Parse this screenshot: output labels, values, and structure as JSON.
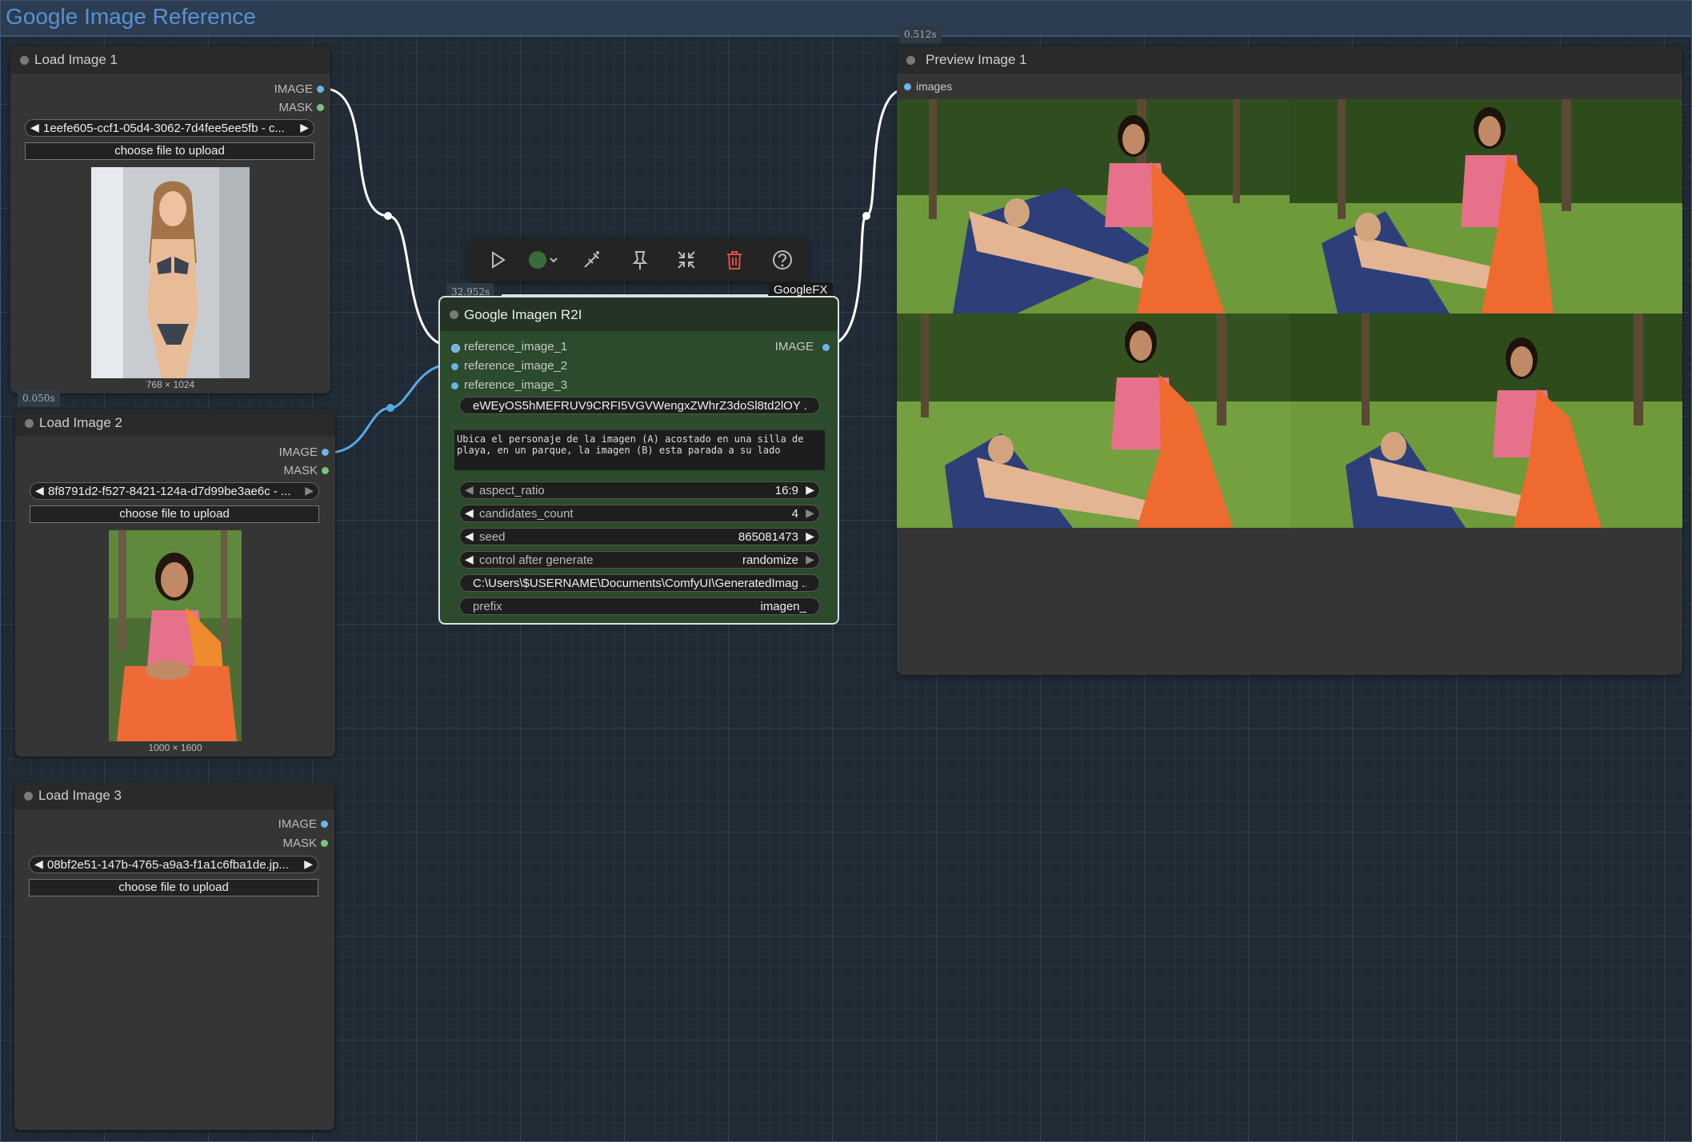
{
  "group": {
    "title": "Google Image Reference"
  },
  "nodes": {
    "load1": {
      "title": "Load Image 1",
      "outputs": [
        "IMAGE",
        "MASK"
      ],
      "file": "1eefe605-ccf1-05d4-3062-7d4fee5ee5fb - c...",
      "upload_label": "choose file to upload",
      "size": "768 × 1024"
    },
    "load2": {
      "badge": "0.050s",
      "title": "Load Image 2",
      "outputs": [
        "IMAGE",
        "MASK"
      ],
      "file": "8f8791d2-f527-8421-124a-d7d99be3ae6c - ...",
      "upload_label": "choose file to upload",
      "size": "1000 × 1600"
    },
    "load3": {
      "title": "Load Image 3",
      "outputs": [
        "IMAGE",
        "MASK"
      ],
      "file": "08bf2e51-147b-4765-a9a3-f1a1c6fba1de.jp...",
      "upload_label": "choose file to upload"
    },
    "imagen": {
      "badge": "32.952s",
      "tag": "GoogleFX",
      "title": "Google Imagen R2I",
      "inputs": [
        "reference_image_1",
        "reference_image_2",
        "reference_image_3"
      ],
      "output": "IMAGE",
      "api_key": "eWEyOS5hMEFRUV9CRFI5VGVWengxZWhrZ3doSl8td2lOY ...",
      "prompt": "Ubica el personaje de la imagen (A) acostado en una silla de\nplaya, en un parque, la imagen (B) esta parada a su lado",
      "widgets": [
        {
          "label": "aspect_ratio",
          "value": "16:9"
        },
        {
          "label": "candidates_count",
          "value": "4"
        },
        {
          "label": "seed",
          "value": "865081473"
        },
        {
          "label": "control after generate",
          "value": "randomize"
        }
      ],
      "output_path": "C:\\Users\\$USERNAME\\Documents\\ComfyUI\\GeneratedImag ...",
      "prefix": {
        "label": "prefix",
        "value": "imagen_"
      }
    },
    "preview": {
      "badge": "0.512s",
      "title": "Preview Image 1",
      "input": "images"
    }
  },
  "colors": {
    "image_socket": "#6cb4e8",
    "mask_socket": "#7ac47a",
    "node_green": "#2c4a2c",
    "group_title": "#5a8fd2"
  }
}
